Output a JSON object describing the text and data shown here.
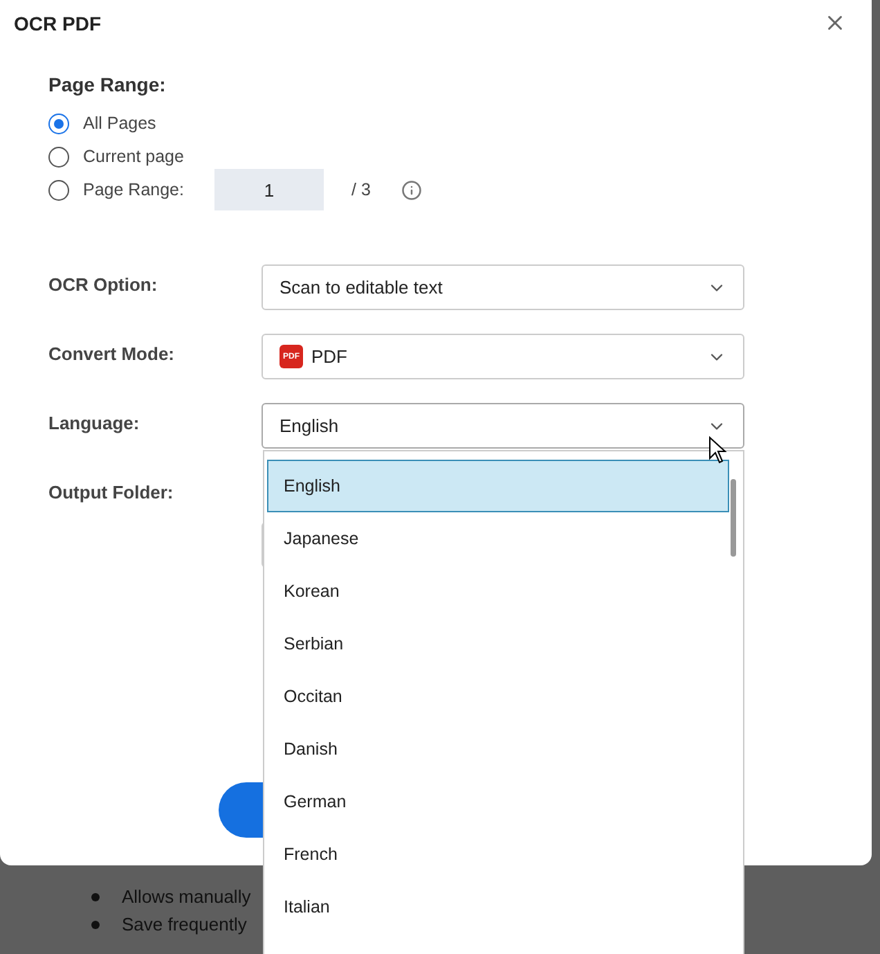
{
  "dialog": {
    "title": "OCR PDF",
    "page_range": {
      "heading": "Page Range:",
      "options": [
        {
          "label": "All Pages",
          "selected": true
        },
        {
          "label": "Current page",
          "selected": false
        },
        {
          "label": "Page Range:",
          "selected": false
        }
      ],
      "from": "1",
      "total": "/ 3"
    },
    "fields": [
      {
        "label": "OCR Option:",
        "kind": "select",
        "value": "Scan to editable text"
      },
      {
        "label": "Convert Mode:",
        "kind": "select",
        "value": "PDF",
        "badge": "PDF"
      },
      {
        "label": "Language:",
        "kind": "select",
        "value": "English",
        "open": true
      },
      {
        "label": "Output Folder:",
        "kind": "folder"
      }
    ],
    "language_menu": {
      "items": [
        {
          "label": "English",
          "selected": true
        },
        {
          "label": "Japanese",
          "selected": false
        },
        {
          "label": "Korean",
          "selected": false
        },
        {
          "label": "Serbian",
          "selected": false
        },
        {
          "label": "Occitan",
          "selected": false
        },
        {
          "label": "Danish",
          "selected": false
        },
        {
          "label": "German",
          "selected": false
        },
        {
          "label": "French",
          "selected": false
        },
        {
          "label": "Italian",
          "selected": false
        }
      ]
    }
  },
  "background": {
    "bullets": [
      "Allows manually",
      "Save frequently"
    ]
  }
}
